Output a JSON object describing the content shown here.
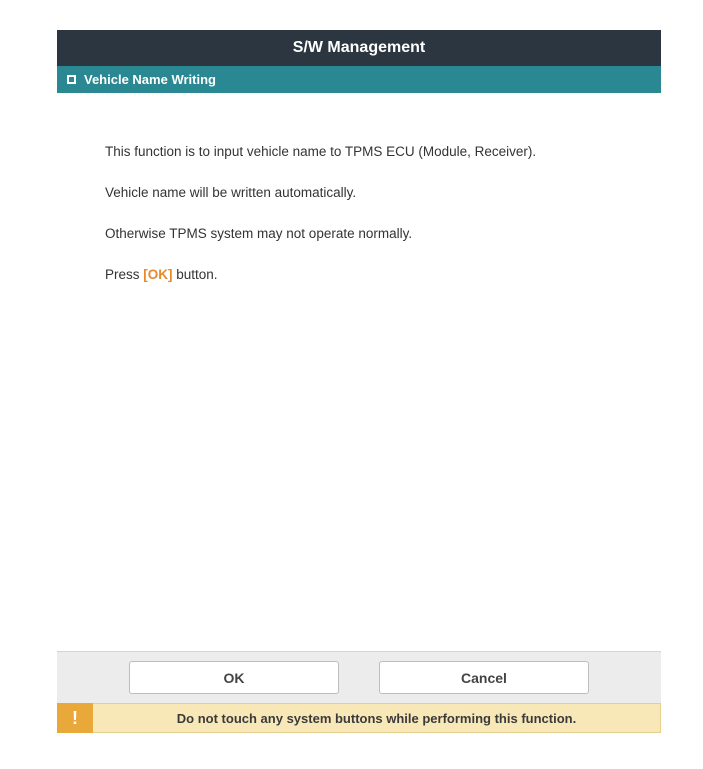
{
  "header": {
    "title": "S/W Management"
  },
  "subheader": {
    "label": "Vehicle Name Writing"
  },
  "content": {
    "line1": "This function is to input vehicle name to TPMS ECU (Module, Receiver).",
    "line2": "Vehicle name will be written automatically.",
    "line3": "Otherwise TPMS system may not operate normally.",
    "press_prefix": "Press ",
    "press_ok": "[OK]",
    "press_suffix": " button."
  },
  "buttons": {
    "ok": "OK",
    "cancel": "Cancel"
  },
  "warning": {
    "icon": "!",
    "text": "Do not touch any system buttons while performing this function."
  }
}
